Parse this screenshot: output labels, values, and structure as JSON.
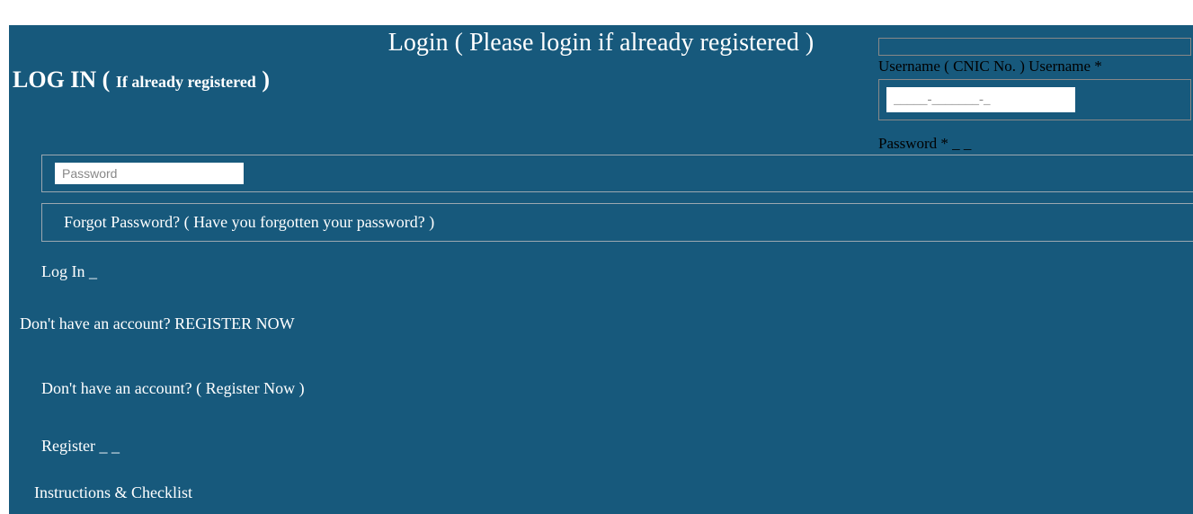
{
  "header": {
    "title": "Login (  Please login if already registered  )"
  },
  "login": {
    "heading_main": "LOG IN ( ",
    "heading_sub": "If already registered",
    "heading_end": " )"
  },
  "username": {
    "label": "Username ( CNIC No. ) Username  *",
    "placeholder": "_____-_______-_"
  },
  "password": {
    "label": "Password *",
    "trail": " _  _",
    "placeholder": "Password"
  },
  "forgot": {
    "text": "Forgot Password? ( Have you forgotten your password? )"
  },
  "login_button": {
    "label": "Log In",
    "trail": " _"
  },
  "register_caps": {
    "prefix": "Don't have an account? ",
    "link": "REGISTER NOW"
  },
  "register_lower": {
    "text": "Don't have an account?  (  Register Now )"
  },
  "register_button": {
    "label": "Register",
    "trail": " _ _"
  },
  "instructions": {
    "label": "Instructions  & Checklist"
  }
}
